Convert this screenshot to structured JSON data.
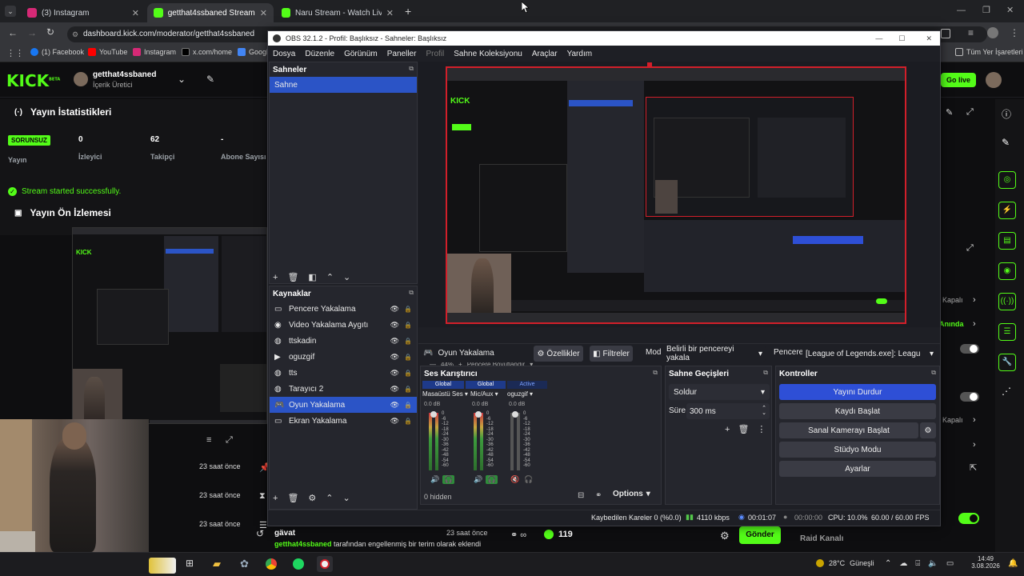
{
  "browser": {
    "tabs": [
      {
        "label": "(3) Instagram",
        "color": "#d62976"
      },
      {
        "label": "getthat4ssbaned Stream - Kick",
        "color": "#53fc18"
      },
      {
        "label": "Naru Stream - Watch Live on Ki",
        "color": "#53fc18"
      }
    ],
    "url": "dashboard.kick.com/moderator/getthat4ssbaned",
    "bookmarks": [
      {
        "label": "(1) Facebook",
        "color": "#1877f2"
      },
      {
        "label": "YouTube",
        "color": "#ff0000"
      },
      {
        "label": "Instagram",
        "color": "#d62976"
      },
      {
        "label": "x.com/home",
        "color": "#ffffff"
      },
      {
        "label": "Googl",
        "color": "#4285f4"
      }
    ],
    "all_bookmarks": "Tüm Yer İşaretleri"
  },
  "kick": {
    "logo": "KICK",
    "logo_sup": "BETA",
    "user": "getthat4ssbaned",
    "role": "İçerik Üretici",
    "go_live": "Go live",
    "stats_title": "Yayın İstatistikleri",
    "status_badge": "SORUNSUZ",
    "stats": [
      {
        "value": "",
        "label": "Yayın"
      },
      {
        "value": "0",
        "label": "İzleyici"
      },
      {
        "value": "62",
        "label": "Takipçi"
      },
      {
        "value": "-",
        "label": "Abone Sayısı"
      }
    ],
    "success_msg": "Stream started successfully.",
    "preview_title": "Yayın Ön İzlemesi",
    "activity_times": [
      "23 saat önce",
      "23 saat önce",
      "23 saat önce"
    ],
    "chat_user": "gävat",
    "chat_time": "23 saat önce",
    "chat_msg_user": "getthat4ssbaned",
    "chat_msg_text": "tarafından engellenmiş bir terim olarak eklendi",
    "viewer_count": "119",
    "send_label": "Gönder",
    "raid_label": "Raid Kanalı",
    "right_labels": [
      "Kapalı",
      "Anında",
      "Kapalı"
    ]
  },
  "obs": {
    "title": "OBS 32.1.2 - Profil: Başlıksız - Sahneler: Başlıksız",
    "menu": [
      "Dosya",
      "Düzenle",
      "Görünüm",
      "Paneller",
      "Profil",
      "Sahne Koleksiyonu",
      "Araçlar",
      "Yardım"
    ],
    "scenes_title": "Sahneler",
    "scenes": [
      "Sahne"
    ],
    "sources_title": "Kaynaklar",
    "sources": [
      {
        "label": "Pencere Yakalama",
        "icon": "window-icon"
      },
      {
        "label": "Video Yakalama Aygıtı",
        "icon": "camera-icon"
      },
      {
        "label": "ttskadin",
        "icon": "globe-icon"
      },
      {
        "label": "oguzgif",
        "icon": "play-icon"
      },
      {
        "label": "tts",
        "icon": "globe-icon"
      },
      {
        "label": "Tarayıcı 2",
        "icon": "globe-icon"
      },
      {
        "label": "Oyun Yakalama",
        "icon": "gamepad-icon"
      },
      {
        "label": "Ekran Yakalama",
        "icon": "monitor-icon"
      }
    ],
    "selected_source_index": 6,
    "zoom": "44%",
    "zoom_label": "Pencere Boyutlandır",
    "props_source": "Oyun Yakalama",
    "props_btn": "Özellikler",
    "filters_btn": "Filtreler",
    "mode_label": "Mod",
    "mode_value": "Belirli bir pencereyi yakala",
    "window_label": "Pencere",
    "window_value": "[League of Legends.exe]: League of",
    "mixer_title": "Ses Karıştırıcı",
    "mixer_tabs": [
      "Global",
      "Global",
      "Active"
    ],
    "mixer_channels": [
      "Masaüstü Ses",
      "Mic/Aux",
      "oguzgif"
    ],
    "mixer_db": [
      "0.0 dB",
      "0.0 dB",
      "0.0 dB"
    ],
    "meter_ticks": [
      "0",
      "-6",
      "-12",
      "-18",
      "-24",
      "-30",
      "-36",
      "-42",
      "-48",
      "-54",
      "-60"
    ],
    "hidden_label": "0 hidden",
    "options_label": "Options",
    "transitions_title": "Sahne Geçişleri",
    "transition_value": "Soldur",
    "duration_label": "Süre",
    "duration_value": "300 ms",
    "controls_title": "Kontroller",
    "controls": [
      "Yayını Durdur",
      "Kaydı Başlat",
      "Sanal Kamerayı Başlat",
      "Stüdyo Modu",
      "Ayarlar"
    ],
    "status": {
      "dropped": "Kaybedilen Kareler 0 (%0.0)",
      "bitrate": "4110 kbps",
      "live_time": "00:01:07",
      "rec_time": "00:00:00",
      "cpu": "CPU: 10.0%",
      "fps": "60.00 / 60.00 FPS"
    }
  },
  "taskbar": {
    "weather": "28°C",
    "weather_text": "Güneşli",
    "time": "14:49",
    "date": "3.08.2026"
  }
}
